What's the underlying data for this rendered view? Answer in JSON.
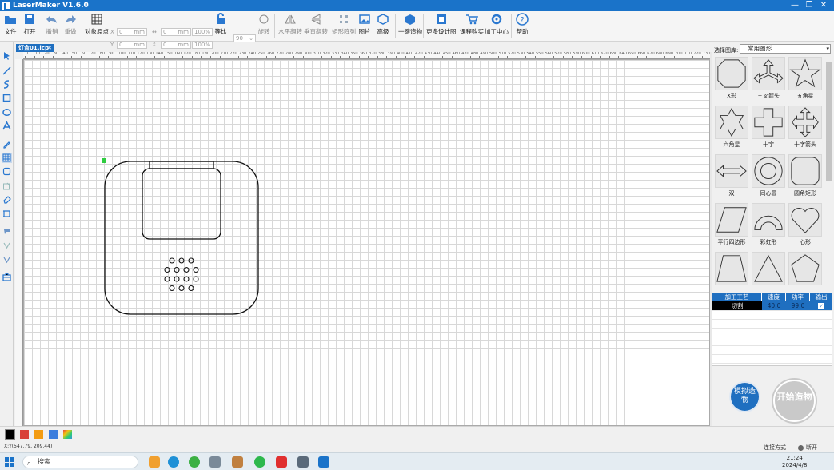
{
  "window": {
    "title": "LaserMaker V1.6.0",
    "controls": [
      "—",
      "❐",
      "✕"
    ]
  },
  "toolbar": {
    "file": "文件",
    "open": "打开",
    "undo": "撤销",
    "redo": "重做",
    "origin": "对象原点",
    "x_label": "X",
    "y_label": "Y",
    "x_value": "0",
    "y_value": "0",
    "unit": "mm",
    "w_value": "0",
    "h_value": "0",
    "pct1": "100",
    "pct2": "100",
    "pct_unit": "%",
    "proportional": "等比",
    "rotate_value": "90",
    "rotate": "旋转",
    "hflip": "水平翻转",
    "vflip": "垂直翻转",
    "array": "矩形阵列",
    "image": "图片",
    "advanced": "高级",
    "make": "一键造物",
    "designs": "更多设计图",
    "course": "课程购买",
    "center": "加工中心",
    "help": "帮助"
  },
  "doc_tab": {
    "name": "灯盒01.lcp",
    "close": "✕"
  },
  "hruler_ticks": [
    "0",
    "10",
    "20",
    "30",
    "40",
    "50",
    "60",
    "70",
    "80",
    "90",
    "100",
    "110",
    "120",
    "130",
    "140",
    "150",
    "160",
    "170",
    "180",
    "190",
    "200",
    "210",
    "220",
    "230",
    "240",
    "250",
    "260",
    "270",
    "280",
    "290",
    "300",
    "310",
    "320",
    "330",
    "340",
    "350",
    "360",
    "370",
    "380",
    "390",
    "400",
    "410",
    "420",
    "430",
    "440",
    "450",
    "460",
    "470",
    "480",
    "490",
    "500",
    "510",
    "520",
    "530",
    "540",
    "550",
    "560",
    "570",
    "580",
    "590",
    "600",
    "610",
    "620",
    "630",
    "640",
    "650",
    "660",
    "670",
    "680",
    "690",
    "700",
    "710",
    "720",
    "730"
  ],
  "library": {
    "label": "选择图库:",
    "selected": "1.常用图形",
    "shapes": [
      "X形",
      "三叉箭头",
      "五角星",
      "六角星",
      "十字",
      "十字箭头",
      "双",
      "同心圆",
      "圆角矩形",
      "平行四边形",
      "彩虹形",
      "心形",
      "梯形",
      "三角形",
      "五边形"
    ]
  },
  "process_table": {
    "headers": [
      "加工工艺",
      "速度",
      "功率",
      "输出"
    ],
    "rows": [
      {
        "process": "切割",
        "speed": "40.0",
        "power": "99.0",
        "output": "✓"
      }
    ]
  },
  "buttons": {
    "simulate": "模拟造物",
    "start": "开始造物"
  },
  "colors": [
    "#000000",
    "#d9413a",
    "#f39c12",
    "#3b7ddd",
    "#7a4bd0"
  ],
  "status": {
    "coords": "X:Y(547.79, 209.44)",
    "connection": "连接方式",
    "state": "断开"
  },
  "taskbar": {
    "search": "搜索",
    "time": "21:24",
    "date": "2024/4/8"
  }
}
